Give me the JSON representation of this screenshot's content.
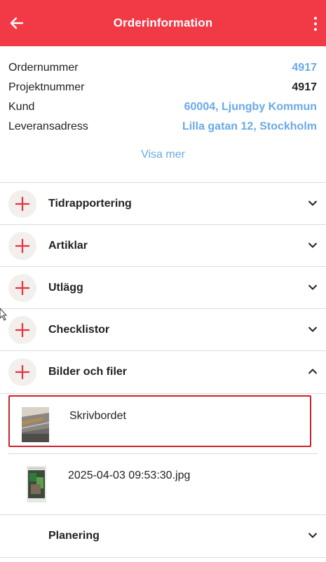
{
  "appbar": {
    "title": "Orderinformation",
    "back_icon": "arrow-left-icon",
    "menu_icon": "more-vertical-icon",
    "color": "#f23a46"
  },
  "order_info": {
    "rows": [
      {
        "label": "Ordernummer",
        "value": "4917"
      },
      {
        "label": "Projektnummer",
        "value": "4917"
      },
      {
        "label": "Kund",
        "value": "60004, Ljungby Kommun"
      },
      {
        "label": "Leveransadress",
        "value": "Lilla gatan 12,  Stockholm"
      }
    ],
    "show_more": "Visa mer",
    "link_color": "#6aa9e9"
  },
  "sections": [
    {
      "label": "Tidrapportering",
      "expanded": false
    },
    {
      "label": "Artiklar",
      "expanded": false
    },
    {
      "label": "Utlägg",
      "expanded": false
    },
    {
      "label": "Checklistor",
      "expanded": false
    },
    {
      "label": "Bilder och filer",
      "expanded": true
    }
  ],
  "files": [
    {
      "name": "Skrivbordet",
      "selected": true
    },
    {
      "name": "2025-04-03 09:53:30.jpg",
      "selected": false
    }
  ],
  "planning": {
    "label": "Planering",
    "expanded": false
  }
}
